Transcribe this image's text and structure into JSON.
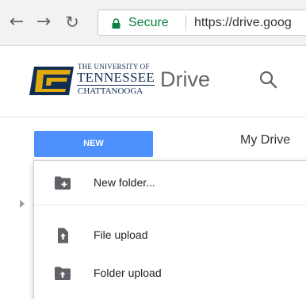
{
  "browser": {
    "back_icon": "back-arrow-icon",
    "forward_icon": "forward-arrow-icon",
    "reload_icon": "reload-icon",
    "secure_label": "Secure",
    "url": "https://drive.goog",
    "secure_color": "#0b8043"
  },
  "header": {
    "university_line1": "THE UNIVERSITY OF",
    "university_line2": "TENNESSEE",
    "university_line3": "CHATTANOOGA",
    "app_name": "Drive",
    "search_icon": "search-icon",
    "brand_navy": "#112e51",
    "brand_gold": "#e0aa0f"
  },
  "toolbar": {
    "new_label": "NEW",
    "new_color": "#4d90fe",
    "breadcrumb": "My Drive"
  },
  "menu": {
    "items": [
      {
        "label": "New folder...",
        "icon": "new-folder-icon"
      },
      {
        "label": "File upload",
        "icon": "file-upload-icon"
      },
      {
        "label": "Folder upload",
        "icon": "folder-upload-icon"
      }
    ]
  }
}
